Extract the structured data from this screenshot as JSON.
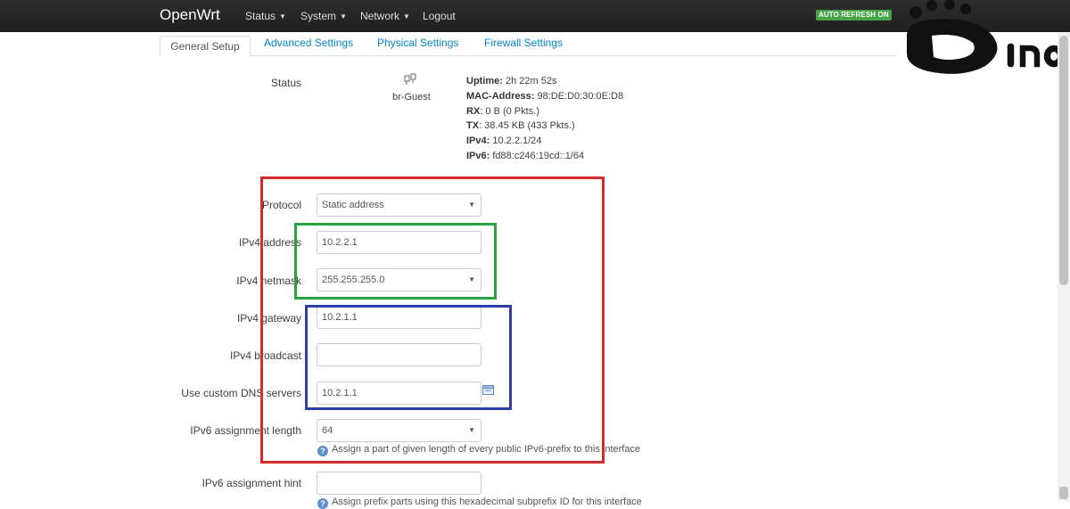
{
  "nav": {
    "brand": "OpenWrt",
    "menu": [
      {
        "label": "Status",
        "has_caret": true
      },
      {
        "label": "System",
        "has_caret": true
      },
      {
        "label": "Network",
        "has_caret": true
      },
      {
        "label": "Logout",
        "has_caret": false
      }
    ],
    "auto_refresh": "AUTO REFRESH ON"
  },
  "tabs": [
    {
      "label": "General Setup",
      "active": true
    },
    {
      "label": "Advanced Settings",
      "active": false
    },
    {
      "label": "Physical Settings",
      "active": false
    },
    {
      "label": "Firewall Settings",
      "active": false
    }
  ],
  "status": {
    "label": "Status",
    "interface_icon": "network-interface-icon",
    "interface_name": "br-Guest",
    "lines": [
      {
        "key": "Uptime:",
        "value": " 2h 22m 52s"
      },
      {
        "key": "MAC-Address:",
        "value": " 98:DE:D0:30:0E:D8"
      },
      {
        "key": "RX",
        "value": ": 0 B (0 Pkts.)"
      },
      {
        "key": "TX",
        "value": ": 38.45 KB (433 Pkts.)"
      },
      {
        "key": "IPv4:",
        "value": " 10.2.2.1/24"
      },
      {
        "key": "IPv6:",
        "value": " fd88:c246:19cd::1/64"
      }
    ]
  },
  "form": {
    "protocol": {
      "label": "Protocol",
      "value": "Static address"
    },
    "ipv4_address": {
      "label": "IPv4 address",
      "value": "10.2.2.1"
    },
    "ipv4_netmask": {
      "label": "IPv4 netmask",
      "value": "255.255.255.0"
    },
    "ipv4_gateway": {
      "label": "IPv4 gateway",
      "value": "10.2.1.1"
    },
    "ipv4_broadcast": {
      "label": "IPv4 broadcast",
      "value": ""
    },
    "dns": {
      "label": "Use custom DNS servers",
      "value": "10.2.1.1"
    },
    "ipv6_length": {
      "label": "IPv6 assignment length",
      "value": "64",
      "help": "Assign a part of given length of every public IPv6-prefix to this interface"
    },
    "ipv6_hint": {
      "label": "IPv6 assignment hint",
      "value": "",
      "help": "Assign prefix parts using this hexadecimal subprefix ID for this interface"
    }
  },
  "logo": {
    "text": "DINO"
  },
  "colors": {
    "annotation_red": "#d72a2a",
    "annotation_green": "#2ea044",
    "annotation_blue": "#2c3fa8",
    "link_blue": "#0088cc",
    "refresh_green": "#46a546"
  }
}
